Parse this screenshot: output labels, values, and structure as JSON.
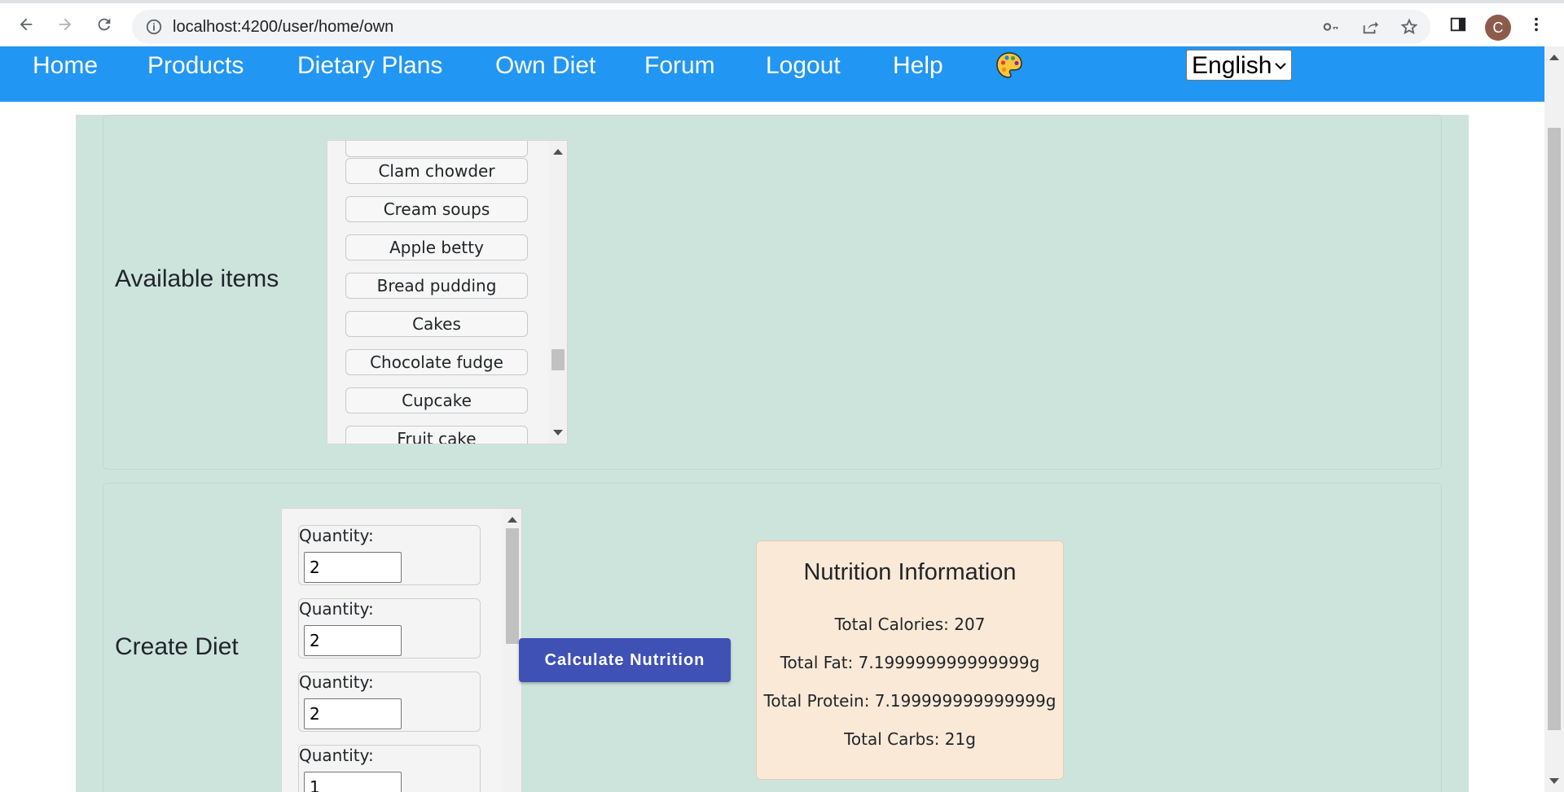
{
  "browser": {
    "url": "localhost:4200/user/home/own",
    "avatar_letter": "C"
  },
  "nav": {
    "items": [
      "Home",
      "Products",
      "Dietary Plans",
      "Own Diet",
      "Forum",
      "Logout",
      "Help"
    ],
    "language": "English"
  },
  "available": {
    "title": "Available items",
    "items": [
      "Clam chowder",
      "Cream soups",
      "Apple betty",
      "Bread pudding",
      "Cakes",
      "Chocolate fudge",
      "Cupcake",
      "Fruit cake"
    ]
  },
  "create": {
    "title": "Create Diet",
    "quantity_label": "Quantity:",
    "quantities": [
      "2",
      "2",
      "2",
      "1"
    ],
    "calc_button": "Calculate Nutrition"
  },
  "nutrition": {
    "title": "Nutrition Information",
    "calories": "Total Calories: 207",
    "fat": "Total Fat: 7.199999999999999g",
    "protein": "Total Protein: 7.199999999999999g",
    "carbs": "Total Carbs: 21g"
  },
  "colors": {
    "navbar": "#2196f3",
    "page_background": "#cde4dd",
    "button": "#3f51b5",
    "nutrition_card": "#fbe9d7"
  }
}
